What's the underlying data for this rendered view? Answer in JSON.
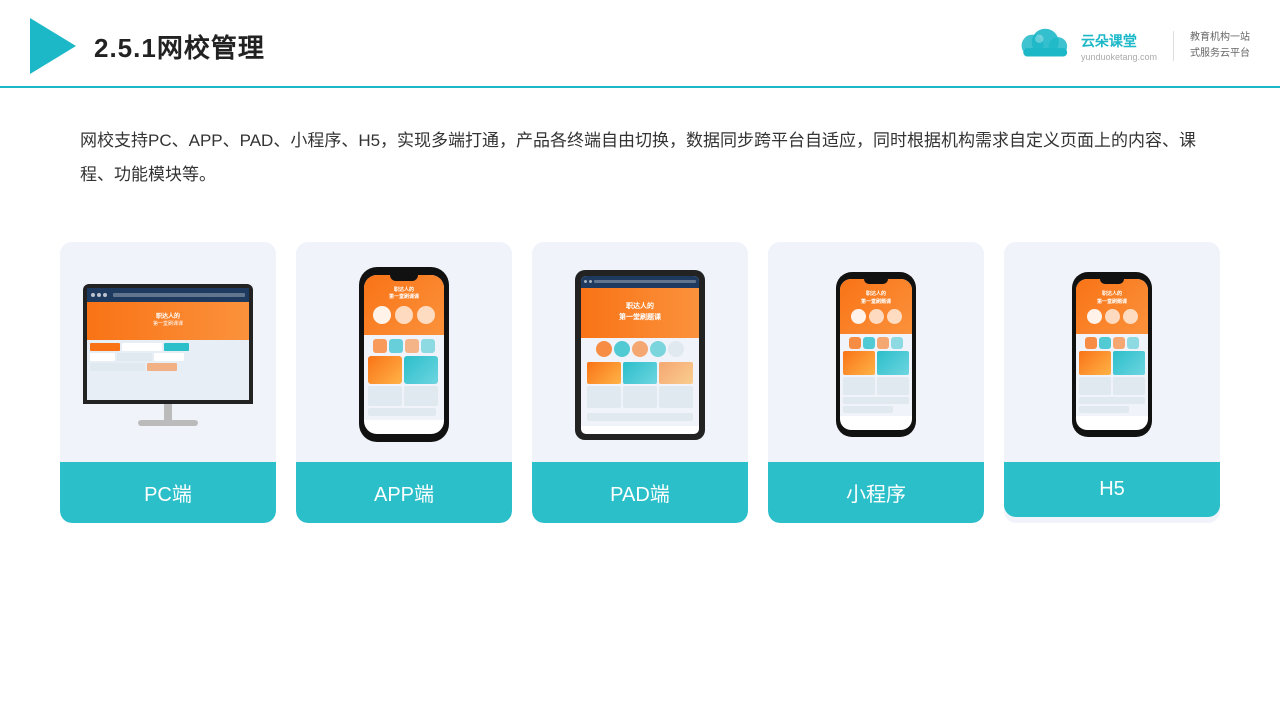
{
  "header": {
    "title": "2.5.1网校管理",
    "brand_name": "云朵课堂",
    "brand_url": "yunduoketang.com",
    "brand_tagline": "教育机构一站\n式服务云平台"
  },
  "description": {
    "text": "网校支持PC、APP、PAD、小程序、H5，实现多端打通，产品各终端自由切换，数据同步跨平台自适应，同时根据机构需求自定义页面上的内容、课程、功能模块等。"
  },
  "cards": [
    {
      "id": "pc",
      "label": "PC端"
    },
    {
      "id": "app",
      "label": "APP端"
    },
    {
      "id": "pad",
      "label": "PAD端"
    },
    {
      "id": "miniprogram",
      "label": "小程序"
    },
    {
      "id": "h5",
      "label": "H5"
    }
  ],
  "colors": {
    "accent": "#2bbfca",
    "header_border": "#1db8c8",
    "card_bg": "#f0f4fa"
  }
}
